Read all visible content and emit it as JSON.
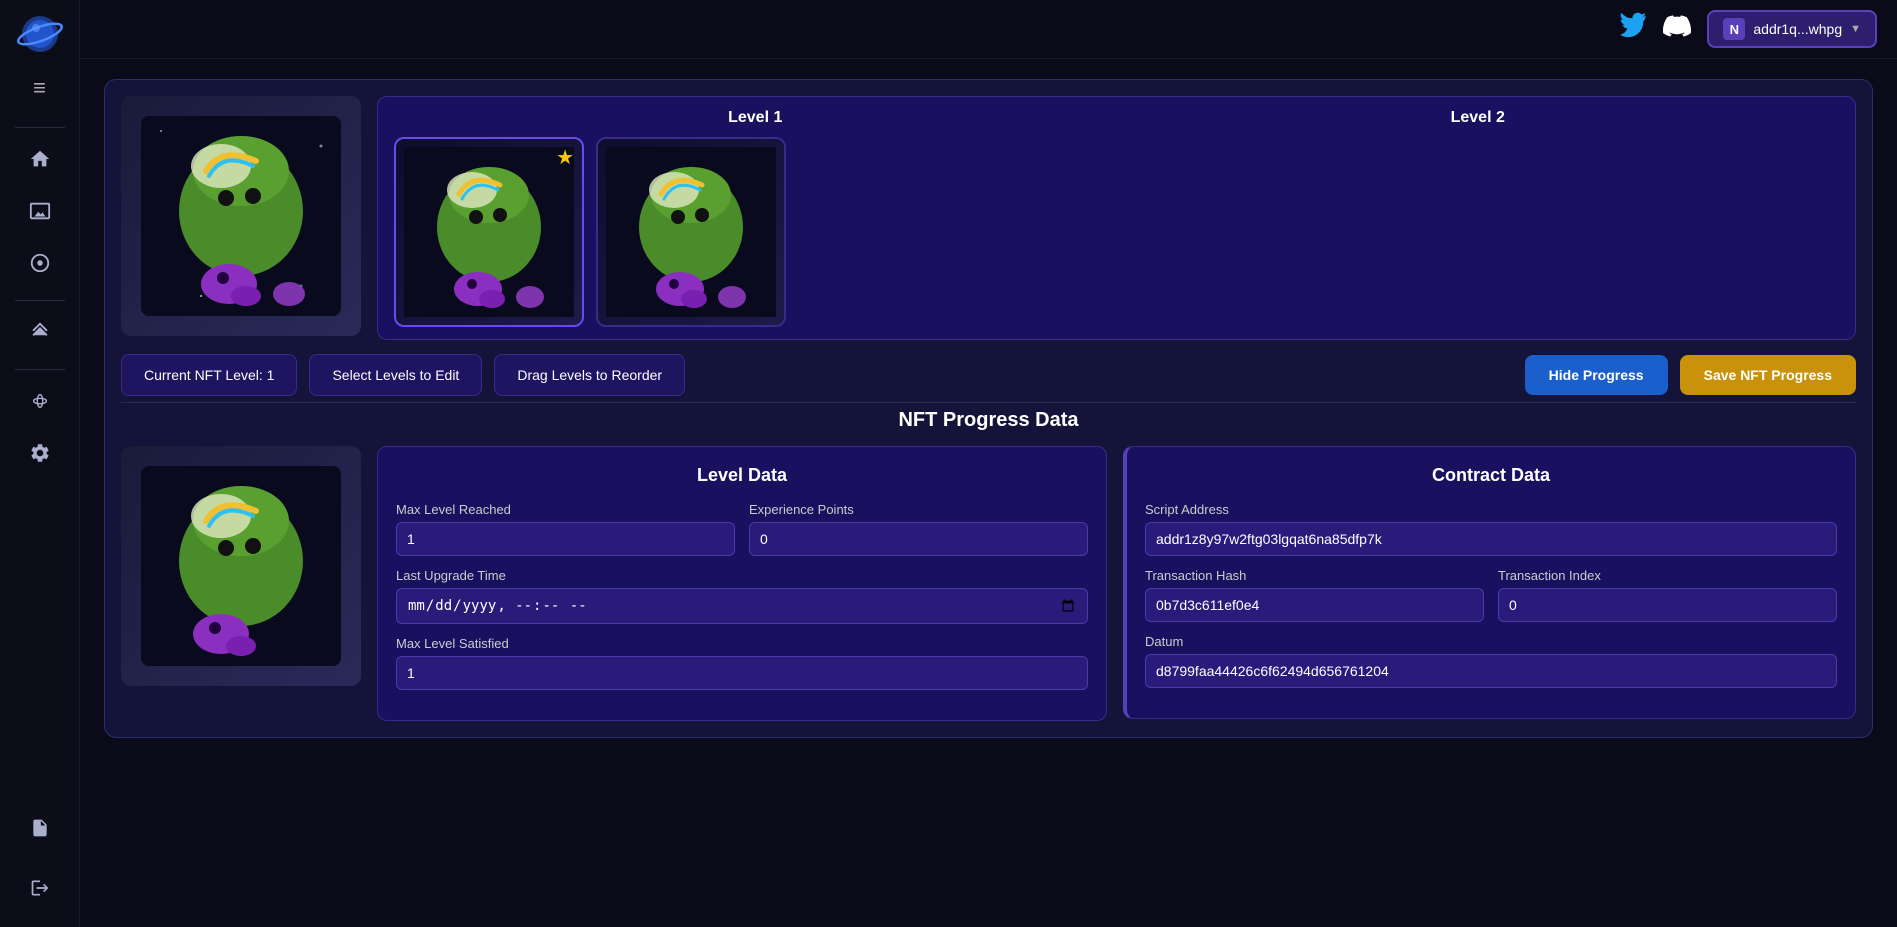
{
  "sidebar": {
    "logo_alt": "Planet Logo",
    "menu_icon": "≡",
    "nav_items": [
      {
        "id": "home",
        "icon": "⌂",
        "label": "Home"
      },
      {
        "id": "gallery",
        "icon": "🖼",
        "label": "Gallery"
      },
      {
        "id": "target",
        "icon": "◎",
        "label": "Target"
      }
    ],
    "secondary_items": [
      {
        "id": "levels",
        "icon": "≫",
        "label": "Levels"
      }
    ],
    "tertiary_items": [
      {
        "id": "bridge",
        "icon": "⧖",
        "label": "Bridge"
      },
      {
        "id": "settings",
        "icon": "⚙",
        "label": "Settings"
      }
    ],
    "bottom_items": [
      {
        "id": "docs",
        "icon": "📋",
        "label": "Docs"
      },
      {
        "id": "exit",
        "icon": "⬚",
        "label": "Exit"
      }
    ]
  },
  "topbar": {
    "twitter_icon": "🐦",
    "discord_icon": "💬",
    "wallet_letter": "N",
    "wallet_address": "addr1q...whpg"
  },
  "levels": {
    "level1_label": "Level 1",
    "level2_label": "Level 2"
  },
  "buttons": {
    "current_nft_level": "Current NFT Level: 1",
    "select_levels": "Select Levels to Edit",
    "drag_levels": "Drag Levels to Reorder",
    "hide_progress": "Hide Progress",
    "save_progress": "Save NFT Progress"
  },
  "progress_section": {
    "title": "NFT Progress Data"
  },
  "level_data": {
    "title": "Level Data",
    "max_level_label": "Max Level Reached",
    "max_level_value": "1",
    "exp_points_label": "Experience Points",
    "exp_points_value": "0",
    "last_upgrade_label": "Last Upgrade Time",
    "last_upgrade_placeholder": "mm/dd/yyyy --:-- --",
    "max_satisfied_label": "Max Level Satisfied",
    "max_satisfied_value": "1"
  },
  "contract_data": {
    "title": "Contract Data",
    "script_address_label": "Script Address",
    "script_address_value": "addr1z8y97w2ftg03lgqat6na85dfp7k",
    "tx_hash_label": "Transaction Hash",
    "tx_hash_value": "0b7d3c611ef0e4",
    "tx_index_label": "Transaction Index",
    "tx_index_value": "0",
    "datum_label": "Datum",
    "datum_value": "d8799faa44426c6f62494d656761204"
  }
}
